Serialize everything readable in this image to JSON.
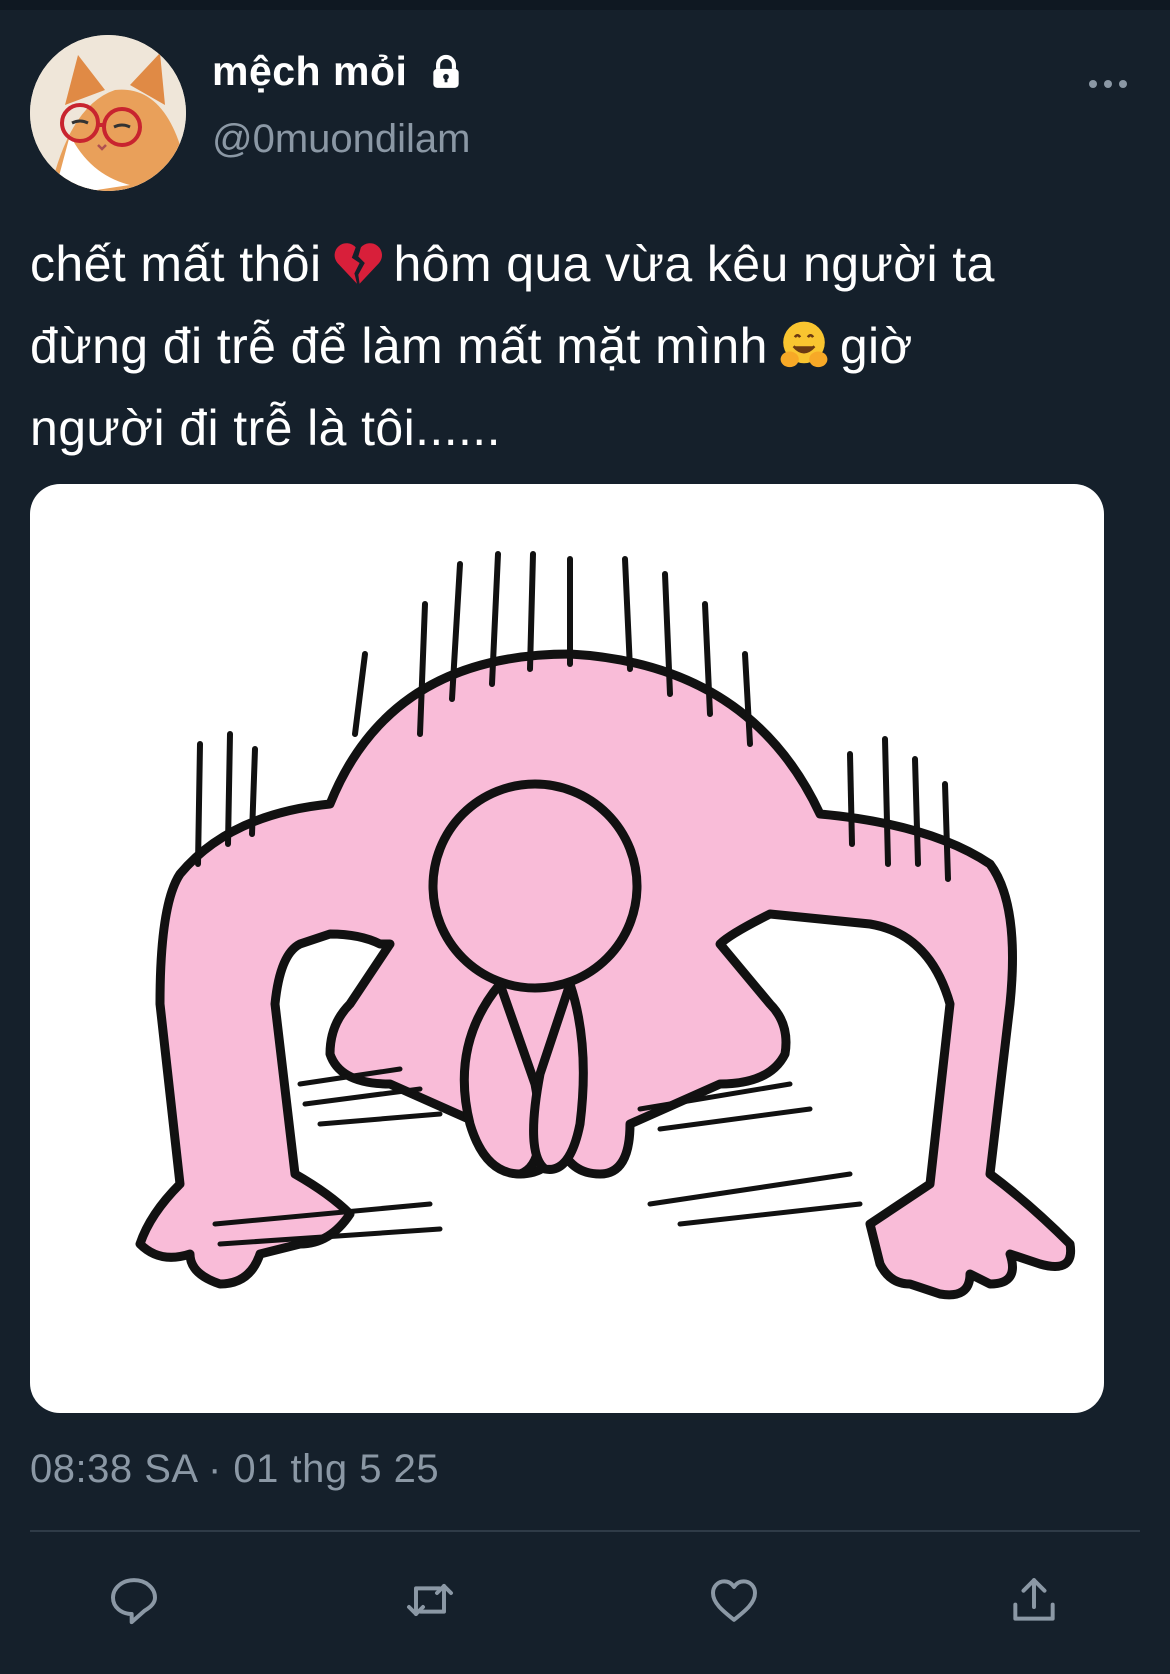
{
  "tweet": {
    "author_name": "mệch mỏi",
    "handle": "@0muondilam",
    "text_lines": [
      {
        "a": "chết mất thôi",
        "emoji": "broken-heart-icon",
        "b": "hôm qua vừa kêu người ta"
      },
      {
        "a": "đừng đi trễ để làm mất mặt mình",
        "emoji": "hugging-face-icon",
        "b": "giờ"
      },
      {
        "a": "người đi trễ là tôi......"
      }
    ],
    "timestamp": "08:38 SA · 01 thg 5 25",
    "media": {
      "subject": "pink bowing cartoon character"
    }
  },
  "icons": {
    "lock": "lock-icon",
    "more": "more-horizontal-icon",
    "reply": "reply-icon",
    "retweet": "retweet-icon",
    "like": "heart-icon",
    "share": "share-icon"
  },
  "colors": {
    "background": "#15202b",
    "secondary_text": "#8b98a5",
    "character_fill": "#f9bcd8"
  }
}
